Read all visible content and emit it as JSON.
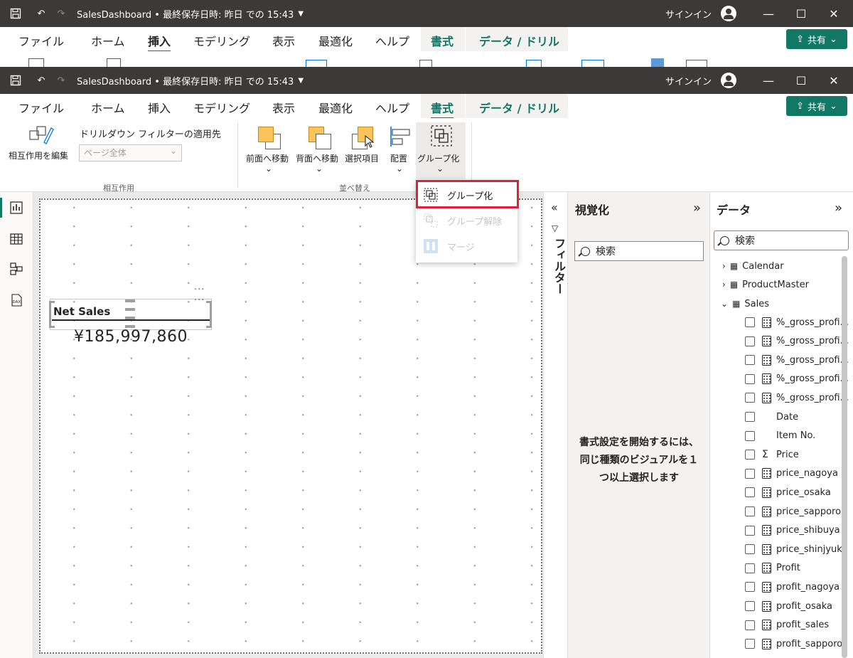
{
  "window": {
    "title": "SalesDashboard • 最終保存日時: 昨日 での 15:43",
    "signin": "サインイン",
    "share_label": "共有"
  },
  "menu": {
    "items": [
      "ファイル",
      "ホーム",
      "挿入",
      "モデリング",
      "表示",
      "最適化",
      "ヘルプ",
      "書式",
      "データ / ドリル"
    ]
  },
  "ribbon": {
    "edit_interactions": "相互作用を編集",
    "drill_filter_label": "ドリルダウン フィルターの適用先",
    "drill_filter_value": "ページ全体",
    "group_interactions": "相互作用",
    "bring_forward": "前面へ移動",
    "send_backward": "背面へ移動",
    "selection": "選択項目",
    "align": "配置",
    "group": "グループ化",
    "group_arrange": "並べ替え"
  },
  "dropdown": {
    "items": [
      {
        "label": "グループ化",
        "enabled": true
      },
      {
        "label": "グループ解除",
        "enabled": false
      },
      {
        "label": "マージ",
        "enabled": false
      }
    ]
  },
  "canvas": {
    "card_title": "Net Sales",
    "card_value": "¥185,997,860"
  },
  "filters": {
    "label": "フィルター"
  },
  "visualizations": {
    "title": "視覚化",
    "search_placeholder": "検索",
    "message": "書式設定を開始するには、同じ種類のビジュアルを１つ以上選択します"
  },
  "data": {
    "title": "データ",
    "search_placeholder": "検索",
    "tables": [
      "Calendar",
      "ProductMaster",
      "Sales"
    ],
    "fields": [
      {
        "name": "%_gross_profi...",
        "icon": "calc"
      },
      {
        "name": "%_gross_profi...",
        "icon": "calc"
      },
      {
        "name": "%_gross_profi...",
        "icon": "calc"
      },
      {
        "name": "%_gross_profi...",
        "icon": "calc"
      },
      {
        "name": "%_gross_profi...",
        "icon": "calc"
      },
      {
        "name": "Date",
        "icon": "none"
      },
      {
        "name": "Item No.",
        "icon": "none"
      },
      {
        "name": "Price",
        "icon": "sigma"
      },
      {
        "name": "price_nagoya",
        "icon": "calc"
      },
      {
        "name": "price_osaka",
        "icon": "calc"
      },
      {
        "name": "price_sapporo",
        "icon": "calc"
      },
      {
        "name": "price_shibuya",
        "icon": "calc"
      },
      {
        "name": "price_shinjyuku",
        "icon": "calc"
      },
      {
        "name": "Profit",
        "icon": "measure"
      },
      {
        "name": "profit_nagoya",
        "icon": "calc"
      },
      {
        "name": "profit_osaka",
        "icon": "calc"
      },
      {
        "name": "profit_sales",
        "icon": "calc"
      },
      {
        "name": "profit_sapporo",
        "icon": "calc"
      }
    ]
  },
  "colors": {
    "accent": "#117865",
    "titlebar": "#3b3a39",
    "highlight": "#e0203b"
  }
}
